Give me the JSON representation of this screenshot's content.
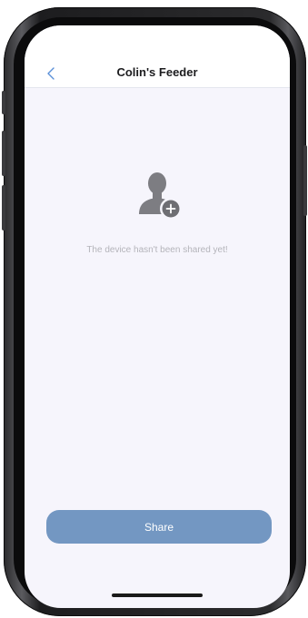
{
  "header": {
    "title": "Colin's Feeder",
    "back_icon": "chevron-left-icon"
  },
  "empty_state": {
    "icon": "add-person-icon",
    "message": "The device hasn't been shared yet!"
  },
  "actions": {
    "share_label": "Share"
  },
  "colors": {
    "accent": "#7397c2",
    "background": "#f6f5fc",
    "nav_background": "#ffffff",
    "muted_text": "#b4b4ba",
    "back_chevron": "#5a8fd8"
  }
}
